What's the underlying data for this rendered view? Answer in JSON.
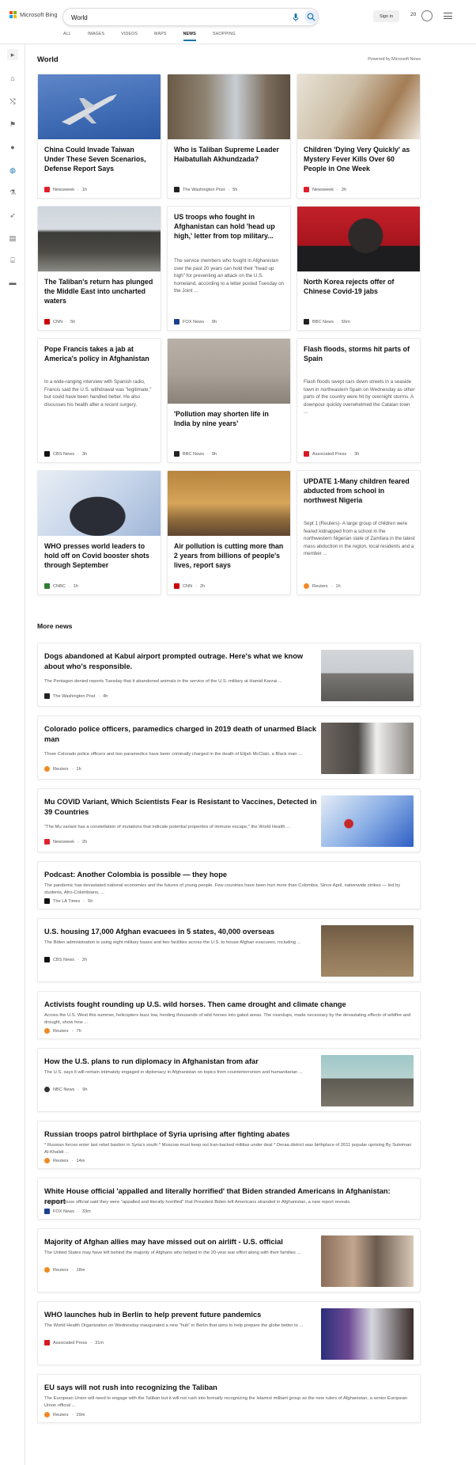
{
  "header": {
    "brand": "Microsoft Bing",
    "query": "World",
    "signin": "Sign in",
    "points": "20"
  },
  "tabs": [
    "ALL",
    "IMAGES",
    "VIDEOS",
    "MAPS",
    "NEWS",
    "SHOPPING"
  ],
  "section": {
    "title": "World",
    "powered": "Powered by Microsoft News"
  },
  "cards": [
    {
      "title": "China Could Invade Taiwan Under These Seven Scenarios, Defense Report Says",
      "source": "Newsweek",
      "time": "1h",
      "color": "#e2202c"
    },
    {
      "title": "Who is Taliban Supreme Leader Haibatullah Akhundzada?",
      "source": "The Washington Post",
      "time": "5h",
      "color": "#222"
    },
    {
      "title": "Children 'Dying Very Quickly' as Mystery Fever Kills Over 60 People in One Week",
      "source": "Newsweek",
      "time": "2h",
      "color": "#e2202c"
    },
    {
      "title": "The Taliban's return has plunged the Middle East into uncharted waters",
      "source": "CNN",
      "time": "5h",
      "color": "#cc0000"
    },
    {
      "title": "US troops who fought in Afghanistan can hold 'head up high,' letter from top military...",
      "snippet": "The service members who fought in Afghanistan over the past 20 years can hold their \"head up high\" for preventing an attack on the U.S. homeland, according to a letter posted Tuesday on the Joint ...",
      "source": "FOX News",
      "time": "9h",
      "color": "#1b3f8f"
    },
    {
      "title": "North Korea rejects offer of Chinese Covid-19 jabs",
      "source": "BBC News",
      "time": "56m",
      "color": "#222"
    },
    {
      "title": "Pope Francis takes a jab at America's policy in Afghanistan",
      "snippet": "In a wide-ranging interview with Spanish radio, Francis said the U.S. withdrawal was \"legitimate,\" but could have been handled better. He also discusses his health after a recent surgery.",
      "source": "CBS News",
      "time": "3h",
      "color": "#111"
    },
    {
      "title": "'Pollution may shorten life in India by nine years'",
      "source": "BBC News",
      "time": "9h",
      "color": "#222"
    },
    {
      "title": "Flash floods, storms hit parts of Spain",
      "snippet": "Flash floods swept cars down streets in a seaside town in northeastern Spain on Wednesday as other parts of the country were hit by overnight storms. A downpour quickly overwhelmed the Catalan town ...",
      "source": "Associated Press",
      "time": "3h",
      "color": "#d71920"
    },
    {
      "title": "WHO presses world leaders to hold off on Covid booster shots through September",
      "source": "CNBC",
      "time": "1h",
      "color": "#2e7d32"
    },
    {
      "title": "Air pollution is cutting more than 2 years from billions of people's lives, report says",
      "source": "CNN",
      "time": "2h",
      "color": "#cc0000"
    },
    {
      "title": "UPDATE 1-Many children feared abducted from school in northwest Nigeria",
      "snippet": "Sept 1 (Reuters)- A large group of children were feared kidnapped from a school in the northwestern Nigerian state of Zamfara in the latest mass abduction in the region, local residents and a member ...",
      "source": "Reuters",
      "time": "1h",
      "color": "#f08a24"
    }
  ],
  "more": {
    "title": "More news",
    "items": [
      {
        "title": "Dogs abandoned at Kabul airport prompted outrage. Here's what we know about who's responsible.",
        "desc": "The Pentagon denied reports Tuesday that it abandoned animals in the service of the U.S. military at Hamid Karzai ...",
        "source": "The Washington Post",
        "time": "4h",
        "color": "#222"
      },
      {
        "title": "Colorado police officers, paramedics charged in 2019 death of unarmed Black man",
        "desc": "Three Colorado police officers and two paramedics have been criminally charged in the death of Elijah McClain, a Black man ...",
        "source": "Reuters",
        "time": "1h",
        "color": "#f08a24"
      },
      {
        "title": "Mu COVID Variant, Which Scientists Fear is Resistant to Vaccines, Detected in 39 Countries",
        "desc": "\"The Mu variant has a constellation of mutations that indicate potential properties of immune escape,\" the World Health ...",
        "source": "Newsweek",
        "time": "2h",
        "color": "#e2202c"
      },
      {
        "title": "Podcast: Another Colombia is possible — they hope",
        "desc": "The pandemic has devastated national economies and the futures of young people. Few countries have been hurt more than Colombia. Since April, nationwide strikes — led by students, Afro-Colombians, ...",
        "source": "The LA Times",
        "time": "5h",
        "color": "#111"
      },
      {
        "title": "U.S. housing 17,000 Afghan evacuees in 5 states, 40,000 overseas",
        "desc": "The Biden administration is using eight military bases and two facilities across the U.S. to house Afghan evacuees, including ...",
        "source": "CBS News",
        "time": "2h",
        "color": "#111"
      },
      {
        "title": "Activists fought rounding up U.S. wild horses. Then came drought and climate change",
        "desc": "Across the U.S. West this summer, helicopters buzz low, herding thousands of wild horses into gated areas. The roundups, made necessary by the devastating effects of wildfire and drought, show how ...",
        "source": "Reuters",
        "time": "7h",
        "color": "#f08a24"
      },
      {
        "title": "How the U.S. plans to run diplomacy in Afghanistan from afar",
        "desc": "The U.S. says it will remain intimately engaged in diplomacy in Afghanistan on topics from counterterrorism and humanitarian ...",
        "source": "NBC News",
        "time": "9h",
        "color": "#333"
      },
      {
        "title": "Russian troops patrol birthplace of Syria uprising after fighting abates",
        "desc": "* Russian forces enter last rebel bastion in Syria's south * Moscow must keep out Iran-backed militias under deal * Deraa district was birthplace of 2011 popular uprising By Suleiman Al-Khalidi ...",
        "source": "Reuters",
        "time": "14m",
        "color": "#f08a24"
      },
      {
        "title": "White House official 'appalled and literally horrified' that Biden stranded Americans in Afghanistan: report",
        "desc": "A White House official said they were \"appalled and literally horrified\" that President Biden left Americans stranded in Afghanistan, a new report reveals.",
        "source": "FOX News",
        "time": "33m",
        "color": "#1b3f8f"
      },
      {
        "title": "Majority of Afghan allies may have missed out on airlift - U.S. official",
        "desc": "The United States may have left behind the majority of Afghans who helped in the 20-year war effort along with their families ...",
        "source": "Reuters",
        "time": "18m",
        "color": "#f08a24"
      },
      {
        "title": "WHO launches hub in Berlin to help prevent future pandemics",
        "desc": "The World Health Organization on Wednesday inaugurated a new \"hub\" in Berlin that aims to help prepare the globe better to ...",
        "source": "Associated Press",
        "time": "31m",
        "color": "#d71920"
      },
      {
        "title": "EU says will not rush into recognizing the Taliban",
        "desc": "The European Union will need to engage with the Taliban but it will not rush into formally recognizing the Islamist militant group as the new rulers of Afghanistan, a senior European Union official ...",
        "source": "Reuters",
        "time": "29m",
        "color": "#f08a24"
      }
    ]
  }
}
